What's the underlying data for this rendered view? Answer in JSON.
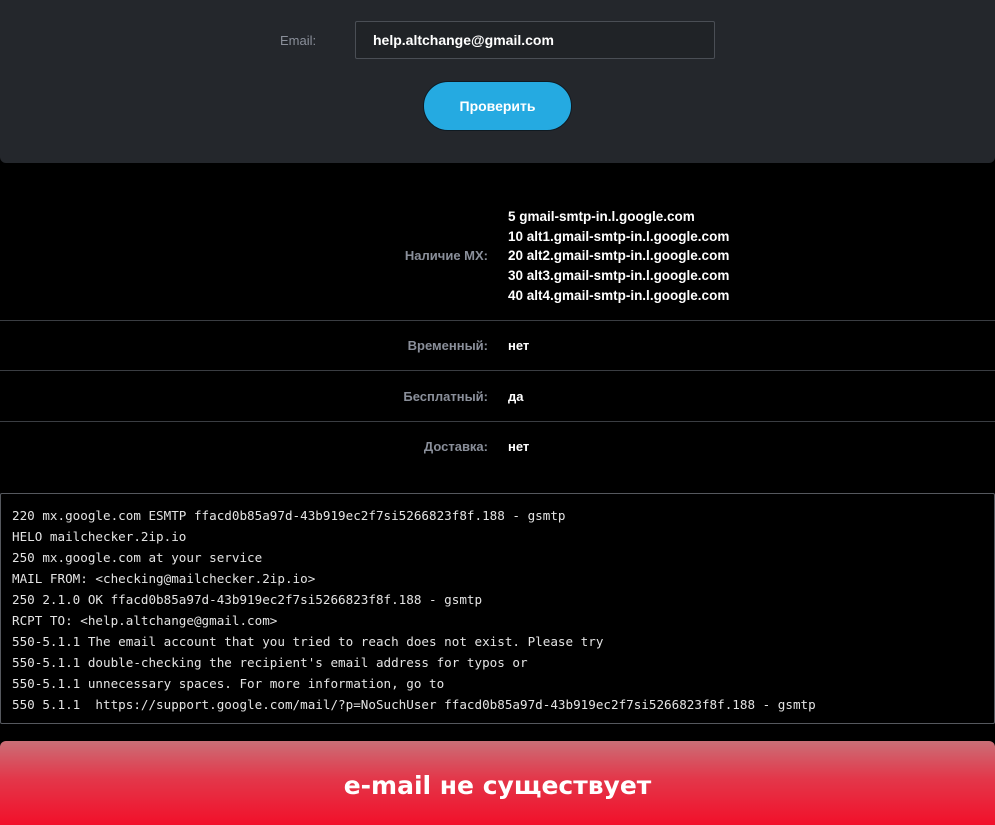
{
  "form": {
    "email_label": "Email:",
    "email_value": "help.altchange@gmail.com",
    "check_button": "Проверить"
  },
  "results": {
    "mx_label": "Наличие MX:",
    "mx_records": [
      {
        "priority": "5",
        "host": "gmail-smtp-in.l.google.com"
      },
      {
        "priority": "10",
        "host": "alt1.gmail-smtp-in.l.google.com"
      },
      {
        "priority": "20",
        "host": "alt2.gmail-smtp-in.l.google.com"
      },
      {
        "priority": "30",
        "host": "alt3.gmail-smtp-in.l.google.com"
      },
      {
        "priority": "40",
        "host": "alt4.gmail-smtp-in.l.google.com"
      }
    ],
    "temporary_label": "Временный:",
    "temporary_value": "нет",
    "free_label": "Бесплатный:",
    "free_value": "да",
    "delivery_label": "Доставка:",
    "delivery_value": "нет"
  },
  "smtp_log": [
    "220 mx.google.com ESMTP ffacd0b85a97d-43b919ec2f7si5266823f8f.188 - gsmtp",
    "HELO mailchecker.2ip.io",
    "250 mx.google.com at your service",
    "MAIL FROM: <checking@mailchecker.2ip.io>",
    "250 2.1.0 OK ffacd0b85a97d-43b919ec2f7si5266823f8f.188 - gsmtp",
    "RCPT TO: <help.altchange@gmail.com>",
    "550-5.1.1 The email account that you tried to reach does not exist. Please try",
    "550-5.1.1 double-checking the recipient's email address for typos or",
    "550-5.1.1 unnecessary spaces. For more information, go to",
    "550 5.1.1  https://support.google.com/mail/?p=NoSuchUser ffacd0b85a97d-43b919ec2f7si5266823f8f.188 - gsmtp"
  ],
  "result_banner": "e-mail не существует",
  "colors": {
    "accent_button": "#25aae1",
    "panel_bg": "#24272c",
    "banner_red": "#f2102a"
  }
}
